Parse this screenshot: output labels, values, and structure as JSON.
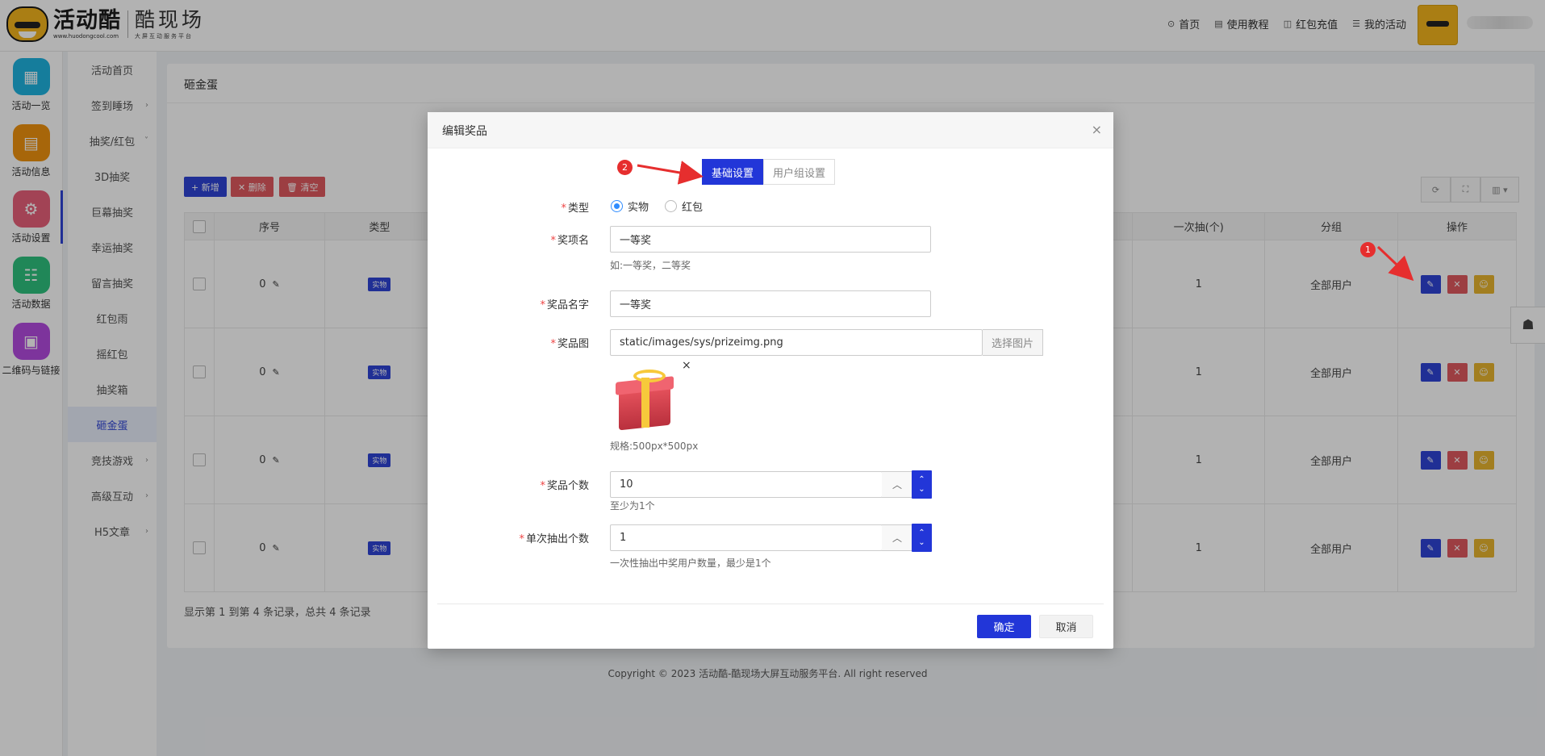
{
  "header": {
    "logo_main": "活动酷",
    "logo_url": "www.huodongcool.com",
    "logo_side_main": "酷现场",
    "logo_side_sub": "大屏互动服务平台",
    "nav": [
      {
        "label": "首页",
        "icon": "home-icon",
        "glyph": "⊙"
      },
      {
        "label": "使用教程",
        "icon": "book-icon",
        "glyph": "▤"
      },
      {
        "label": "红包充值",
        "icon": "wallet-icon",
        "glyph": "◫"
      },
      {
        "label": "我的活动",
        "icon": "list-icon",
        "glyph": "☰"
      }
    ]
  },
  "sidebar": {
    "items": [
      {
        "label": "活动一览",
        "icon": "grid-icon",
        "glyph": "▦",
        "color": "#1fb3e0"
      },
      {
        "label": "活动信息",
        "icon": "document-icon",
        "glyph": "▤",
        "color": "#f0930f"
      },
      {
        "label": "活动设置",
        "icon": "gear-icon",
        "glyph": "⚙",
        "color": "#e8607a"
      },
      {
        "label": "活动数据",
        "icon": "database-icon",
        "glyph": "☷",
        "color": "#2ec27e"
      },
      {
        "label": "二维码与链接",
        "icon": "qrcode-icon",
        "glyph": "▣",
        "color": "#b44be0"
      }
    ]
  },
  "submenu": {
    "items": [
      {
        "label": "活动首页",
        "chev": ""
      },
      {
        "label": "签到睡场",
        "chev": "›"
      },
      {
        "label": "抽奖/红包",
        "chev": "˅"
      },
      {
        "label": "3D抽奖",
        "chev": ""
      },
      {
        "label": "巨幕抽奖",
        "chev": ""
      },
      {
        "label": "幸运抽奖",
        "chev": ""
      },
      {
        "label": "留言抽奖",
        "chev": ""
      },
      {
        "label": "红包雨",
        "chev": ""
      },
      {
        "label": "摇红包",
        "chev": ""
      },
      {
        "label": "抽奖箱",
        "chev": ""
      },
      {
        "label": "砸金蛋",
        "chev": ""
      },
      {
        "label": "竞技游戏",
        "chev": "›"
      },
      {
        "label": "高级互动",
        "chev": "›"
      },
      {
        "label": "H5文章",
        "chev": "›"
      }
    ]
  },
  "page": {
    "title": "砸金蛋",
    "toolbar": {
      "add": "+ 新增",
      "delete": "✕ 删除",
      "clear": "🗑 清空",
      "refresh_glyph": "⟳",
      "fullscreen_glyph": "⛶",
      "columns_glyph": "▥ ▾"
    },
    "columns": {
      "seq": "序号",
      "type": "类型",
      "once": "一次抽(个)",
      "group": "分组",
      "action": "操作"
    },
    "rows": [
      {
        "seq": "0",
        "type": "实物",
        "once": "1",
        "group": "全部用户"
      },
      {
        "seq": "0",
        "type": "实物",
        "once": "1",
        "group": "全部用户"
      },
      {
        "seq": "0",
        "type": "实物",
        "once": "1",
        "group": "全部用户"
      },
      {
        "seq": "0",
        "type": "实物",
        "once": "1",
        "group": "全部用户"
      }
    ],
    "action_glyphs": {
      "edit": "✎",
      "delete": "✕",
      "user": "☺"
    },
    "pagination": "显示第 1 到第 4 条记录，总共 4 条记录",
    "copyright": "Copyright © 2023 活动酷-酷现场大屏互动服务平台. All right reserved"
  },
  "modal": {
    "title": "编辑奖品",
    "close_glyph": "×",
    "tabs": [
      "基础设置",
      "用户组设置"
    ],
    "fields": {
      "type_label": "类型",
      "type_options": [
        "实物",
        "红包"
      ],
      "award_name_label": "奖项名",
      "award_name_value": "一等奖",
      "award_name_hint": "如:一等奖，二等奖",
      "prize_name_label": "奖品名字",
      "prize_name_value": "一等奖",
      "prize_image_label": "奖品图",
      "prize_image_value": "static/images/sys/prizeimg.png",
      "prize_image_button": "选择图片",
      "prize_image_remove": "×",
      "prize_image_hint": "规格:500px*500px",
      "prize_count_label": "奖品个数",
      "prize_count_value": "10",
      "prize_count_hint": "至少为1个",
      "per_draw_label": "单次抽出个数",
      "per_draw_value": "1",
      "per_draw_hint": "一次性抽出中奖用户数量，最少是1个"
    },
    "ok": "确定",
    "cancel": "取消"
  },
  "annotations": [
    "1",
    "2"
  ],
  "float_widget_glyph": "☗"
}
